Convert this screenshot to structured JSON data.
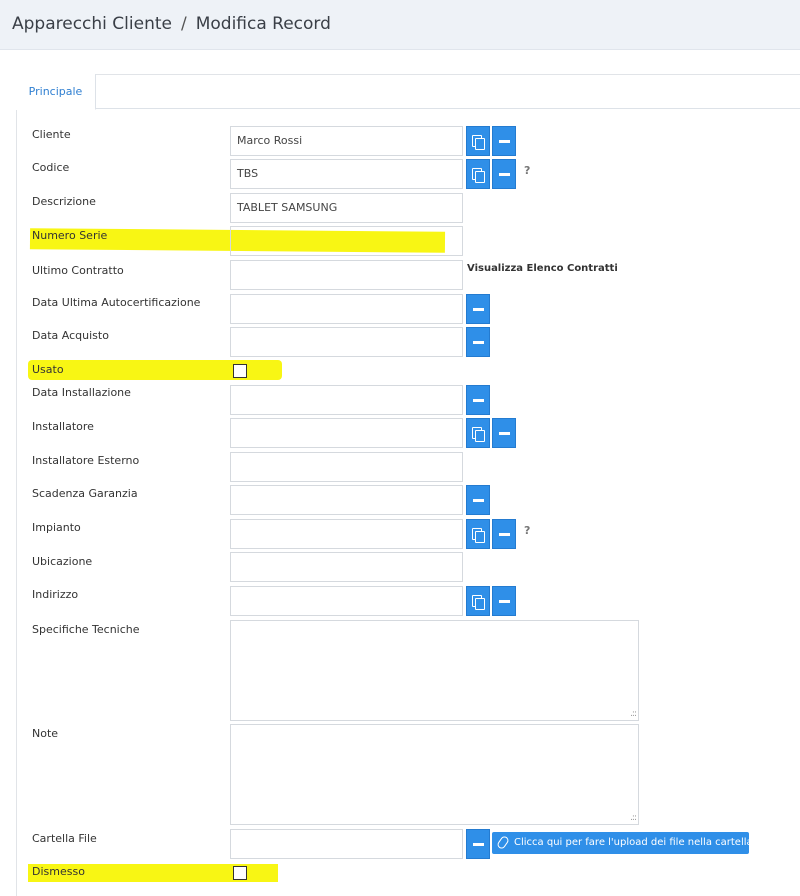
{
  "breadcrumb": {
    "parent": "Apparecchi Cliente",
    "separator": "/",
    "current": "Modifica Record"
  },
  "tabs": [
    {
      "label": "Principale",
      "active": true
    }
  ],
  "form": {
    "cliente": {
      "label": "Cliente",
      "value": "Marco Rossi"
    },
    "codice": {
      "label": "Codice",
      "value": "TBS",
      "help": "?"
    },
    "descrizione": {
      "label": "Descrizione",
      "value": "TABLET SAMSUNG"
    },
    "numero_serie": {
      "label": "Numero Serie",
      "value": ""
    },
    "ultimo_contratto": {
      "label": "Ultimo Contratto",
      "value": "",
      "link": "Visualizza Elenco Contratti"
    },
    "data_ultima_autocert": {
      "label": "Data Ultima Autocertificazione",
      "value": ""
    },
    "data_acquisto": {
      "label": "Data Acquisto",
      "value": ""
    },
    "usato": {
      "label": "Usato",
      "checked": false
    },
    "data_installazione": {
      "label": "Data Installazione",
      "value": ""
    },
    "installatore": {
      "label": "Installatore",
      "value": ""
    },
    "installatore_esterno": {
      "label": "Installatore Esterno",
      "value": ""
    },
    "scadenza_garanzia": {
      "label": "Scadenza Garanzia",
      "value": ""
    },
    "impianto": {
      "label": "Impianto",
      "value": "",
      "help": "?"
    },
    "ubicazione": {
      "label": "Ubicazione",
      "value": ""
    },
    "indirizzo": {
      "label": "Indirizzo",
      "value": ""
    },
    "specifiche_tecniche": {
      "label": "Specifiche Tecniche",
      "value": ""
    },
    "note": {
      "label": "Note",
      "value": ""
    },
    "cartella_file": {
      "label": "Cartella File",
      "value": "",
      "upload_label": "Clicca qui per fare l'upload dei file nella cartella"
    },
    "dismesso": {
      "label": "Dismesso",
      "checked": false
    }
  },
  "colors": {
    "accent": "#2f8fe8",
    "highlight": "#f7f500",
    "header_bg": "#eef2f7",
    "tab_text": "#2f7fd1"
  },
  "icons": {
    "copy": "copy-icon",
    "minus": "minus-icon",
    "clip": "paperclip-icon",
    "resize": "resize-grip-icon"
  }
}
